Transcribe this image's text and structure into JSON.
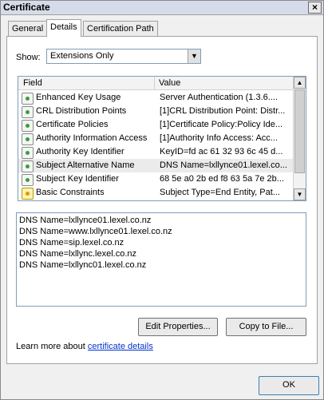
{
  "window": {
    "title": "Certificate",
    "close_label": "×"
  },
  "tabs": [
    "General",
    "Details",
    "Certification Path"
  ],
  "show": {
    "label": "Show:",
    "value": "Extensions Only",
    "dropdown_arrow": "▼"
  },
  "table": {
    "headers": {
      "field": "Field",
      "value": "Value"
    },
    "rows": [
      {
        "field": "Enhanced Key Usage",
        "value": "Server Authentication (1.3.6...."
      },
      {
        "field": "CRL Distribution Points",
        "value": "[1]CRL Distribution Point: Distr..."
      },
      {
        "field": "Certificate Policies",
        "value": "[1]Certificate Policy:Policy Ide..."
      },
      {
        "field": "Authority Information Access",
        "value": "[1]Authority Info Access: Acc..."
      },
      {
        "field": "Authority Key Identifier",
        "value": "KeyID=fd ac 61 32 93 6c 45 d..."
      },
      {
        "field": "Subject Alternative Name",
        "value": "DNS Name=lxllynce01.lexel.co..."
      },
      {
        "field": "Subject Key Identifier",
        "value": "68 5e a0 2b ed f8 63 5a 7e 2b..."
      },
      {
        "field": "Basic Constraints",
        "value": "Subject Type=End Entity, Pat..."
      }
    ],
    "scroll_up": "▲",
    "scroll_down": "▼"
  },
  "details_text": [
    "DNS Name=lxllynce01.lexel.co.nz",
    "DNS Name=www.lxllynce01.lexel.co.nz",
    "DNS Name=sip.lexel.co.nz",
    "DNS Name=lxllync.lexel.co.nz",
    "DNS Name=lxllync01.lexel.co.nz"
  ],
  "buttons": {
    "edit_properties": "Edit Properties...",
    "copy_to_file": "Copy to File...",
    "ok": "OK"
  },
  "learn_more": {
    "prefix": "Learn more about ",
    "link": "certificate details"
  }
}
